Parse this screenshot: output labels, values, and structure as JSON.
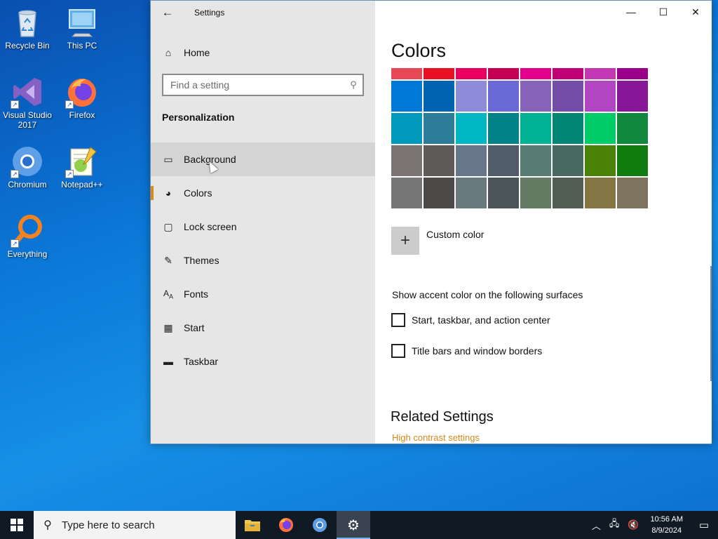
{
  "desktop": {
    "icons": [
      {
        "label": "Recycle Bin",
        "icon": "recycle-bin-icon"
      },
      {
        "label": "This PC",
        "icon": "computer-icon"
      },
      {
        "label": "Visual Studio 2017",
        "icon": "visual-studio-icon"
      },
      {
        "label": "Firefox",
        "icon": "firefox-icon"
      },
      {
        "label": "Chromium",
        "icon": "chromium-icon"
      },
      {
        "label": "Notepad++",
        "icon": "notepadpp-icon"
      },
      {
        "label": "Everything",
        "icon": "everything-search-icon"
      }
    ]
  },
  "window": {
    "title": "Settings",
    "nav": {
      "home": "Home",
      "search_placeholder": "Find a setting",
      "section": "Personalization",
      "items": [
        {
          "label": "Background",
          "icon": "image-icon",
          "state": "hover"
        },
        {
          "label": "Colors",
          "icon": "palette-icon",
          "state": "selected"
        },
        {
          "label": "Lock screen",
          "icon": "lock-screen-icon"
        },
        {
          "label": "Themes",
          "icon": "brush-icon"
        },
        {
          "label": "Fonts",
          "icon": "font-icon"
        },
        {
          "label": "Start",
          "icon": "start-tiles-icon"
        },
        {
          "label": "Taskbar",
          "icon": "taskbar-icon"
        }
      ]
    },
    "content": {
      "title": "Colors",
      "swatch_rows": [
        [
          "#e74856",
          "#e81123",
          "#ea005e",
          "#c30052",
          "#e3008c",
          "#bf0077",
          "#c239b3",
          "#9a0089"
        ],
        [
          "#0078d7",
          "#0063b1",
          "#8e8cd8",
          "#6b69d6",
          "#8764b8",
          "#744da9",
          "#b146c2",
          "#881798"
        ],
        [
          "#0099bc",
          "#2d7d9a",
          "#00b7c3",
          "#038387",
          "#00b294",
          "#018574",
          "#00cc6a",
          "#10893e"
        ],
        [
          "#7a7574",
          "#5d5a58",
          "#68768a",
          "#515c6b",
          "#567c73",
          "#486860",
          "#498205",
          "#107c10"
        ],
        [
          "#767676",
          "#4c4a48",
          "#69797e",
          "#4a5459",
          "#647c64",
          "#525e54",
          "#847545",
          "#7e735f"
        ]
      ],
      "custom_color": "Custom color",
      "surfaces_label": "Show accent color on the following surfaces",
      "checkboxes": [
        {
          "label": "Start, taskbar, and action center",
          "checked": false
        },
        {
          "label": "Title bars and window borders",
          "checked": false
        }
      ],
      "related_title": "Related Settings",
      "related_link": "High contrast settings"
    }
  },
  "taskbar": {
    "search_placeholder": "Type here to search",
    "apps": [
      {
        "name": "File Explorer",
        "icon": "folder-icon"
      },
      {
        "name": "Firefox",
        "icon": "firefox-icon"
      },
      {
        "name": "Chromium",
        "icon": "chromium-icon"
      },
      {
        "name": "Settings",
        "icon": "gear-icon",
        "active": true
      }
    ],
    "time": "10:56 AM",
    "date": "8/9/2024"
  },
  "colors": {
    "accent_orange": "#e08a16",
    "desktop_blue": "#0b78d8",
    "taskbar_bg": "#101a24"
  }
}
